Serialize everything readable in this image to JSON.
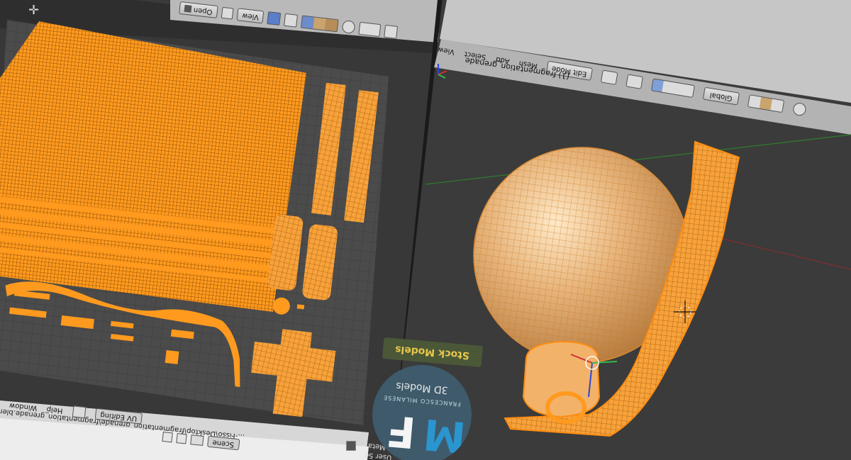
{
  "info_bar": {
    "file_path": "...-Fisso\\Desktop\\fragmentation_grenade\\fragmentation_grenade.blend",
    "menu_window": "Window",
    "menu_help": "Help",
    "layout_name": "UV Editing",
    "scene_name": "Scene"
  },
  "uv_header": {
    "open_label": "Open",
    "view_label": "View"
  },
  "viewport_header": {
    "view_label": "View",
    "select_label": "Select",
    "add_label": "Add",
    "mesh_label": "Mesh",
    "mode_label": "Edit Mode",
    "orientation_label": "Global"
  },
  "viewport": {
    "object_info": "(1) fragmentation_grenade"
  },
  "bottom_left": {
    "text": "Meta",
    "text2": "User Se"
  },
  "watermark": {
    "initials_left": "F",
    "initials_right": "M",
    "line1": "3D Models",
    "arc_text": "FRANCESCO MILANESE",
    "badge_text": "Stock Models"
  },
  "colors": {
    "mesh_orange": "#ff9a1e",
    "grid_dark": "#3d3d3d",
    "grid_light": "#4a4a4a",
    "header_gray": "#b4b4b4",
    "watermark_blue": "#2a9ad6",
    "badge_yellow": "#e8c64a"
  },
  "icons": [
    "cursor-icon",
    "image-icon",
    "view-icon",
    "pin-icon",
    "uv-sync-icon",
    "mode-select-icons",
    "proportional-icon",
    "snap-icon",
    "pivot-icon",
    "manipulator-icons",
    "layer-icon"
  ]
}
